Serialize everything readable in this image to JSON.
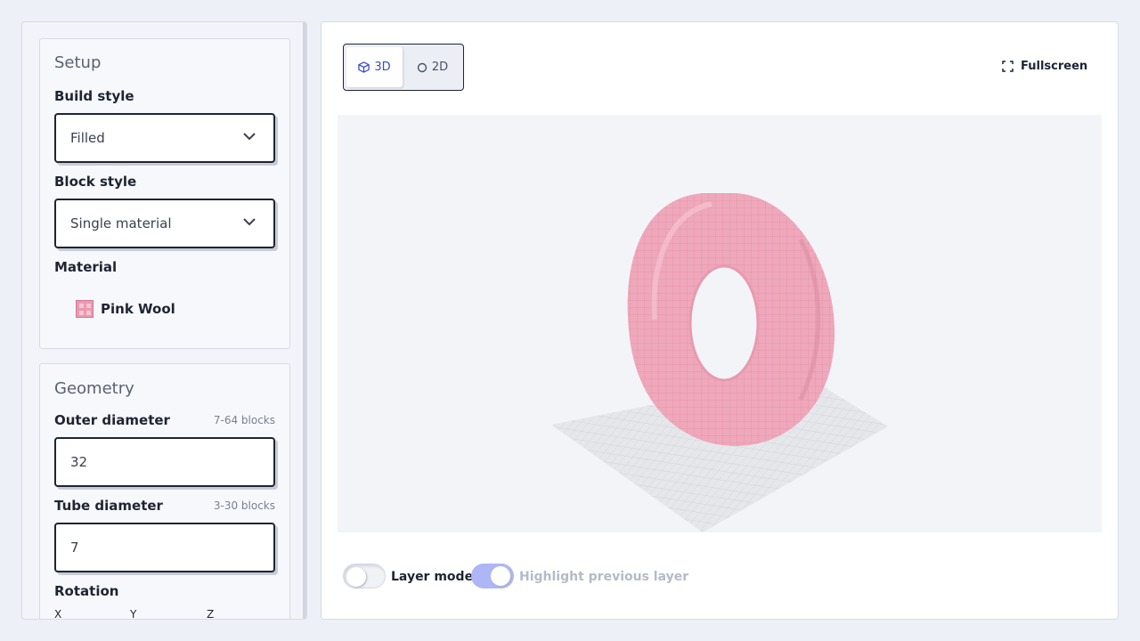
{
  "setup": {
    "title": "Setup",
    "build_style_label": "Build style",
    "build_style_value": "Filled",
    "block_style_label": "Block style",
    "block_style_value": "Single material",
    "material_label": "Material",
    "material_name": "Pink Wool"
  },
  "geometry": {
    "title": "Geometry",
    "outer_label": "Outer diameter",
    "outer_hint": "7-64 blocks",
    "outer_value": "32",
    "tube_label": "Tube diameter",
    "tube_hint": "3-30 blocks",
    "tube_value": "7",
    "rotation_label": "Rotation",
    "axes": [
      "X",
      "Y",
      "Z"
    ]
  },
  "view_toggle": {
    "mode_3d": "3D",
    "mode_2d": "2D",
    "selected": "3D"
  },
  "fullscreen_label": "Fullscreen",
  "controls": {
    "layer_mode_label": "Layer mode",
    "layer_mode_on": false,
    "highlight_label": "Highlight previous layer",
    "highlight_on": true
  },
  "colors": {
    "accent": "#3a4ad0",
    "wool_pink": "#e99ab0",
    "grid": "#d9dbe0"
  },
  "icons": {
    "chevron": "chevron-down-icon",
    "cube": "cube-icon",
    "circle": "circle-icon",
    "fullscreen": "fullscreen-icon"
  }
}
